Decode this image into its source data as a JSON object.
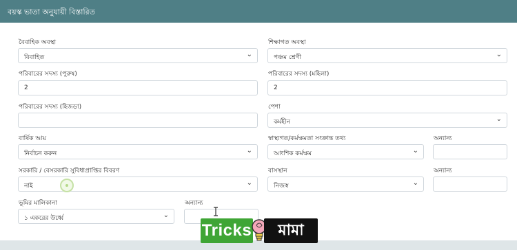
{
  "header": {
    "title": "বয়স্ক ভাতা অনুযায়ী বিস্তারিত"
  },
  "form": {
    "marital_status": {
      "label": "বৈবাহিক অবস্থা",
      "value": "বিবাহিত"
    },
    "education": {
      "label": "শিক্ষাগত অবস্থা",
      "value": "পঞ্চম শ্রেণী"
    },
    "family_male": {
      "label": "পরিবারের সদস্য (পুরুষ)",
      "value": "2"
    },
    "family_female": {
      "label": "পরিবারের সদস্য (মহিলা)",
      "value": "2"
    },
    "family_hijra": {
      "label": "পরিবারের সদস্য (হিজড়া)",
      "value": ""
    },
    "profession": {
      "label": "পেশা",
      "value": "কর্মহীন"
    },
    "annual_income": {
      "label": "বার্ষিক আয়",
      "value": "নির্বাচন করুন"
    },
    "health": {
      "label": "স্বাস্থ্যগত/কর্মক্ষমতা সংক্রান্ত তথ্য",
      "value": "আংশিক কর্মক্ষম"
    },
    "health_other": {
      "label": "অন্যান্য",
      "value": ""
    },
    "govt_benefits": {
      "label": "সরকারি / বেসরকারি সুবিধাপ্রাপ্তির বিবরণ",
      "value": "নাই"
    },
    "residence": {
      "label": "বাসস্থান",
      "value": "নিজস্ব"
    },
    "residence_other": {
      "label": "অন্যান্য",
      "value": ""
    },
    "land": {
      "label": "ভূমির মালিকানা",
      "value": "১ একরের উর্ধ্বে"
    },
    "land_other": {
      "label": "অন্যান্য",
      "value": ""
    }
  },
  "watermark": {
    "left": "Tricks",
    "right": "মামা"
  },
  "colors": {
    "header": "#4f7f86",
    "border": "#cfd6dc",
    "logo_green": "#3fa535"
  }
}
